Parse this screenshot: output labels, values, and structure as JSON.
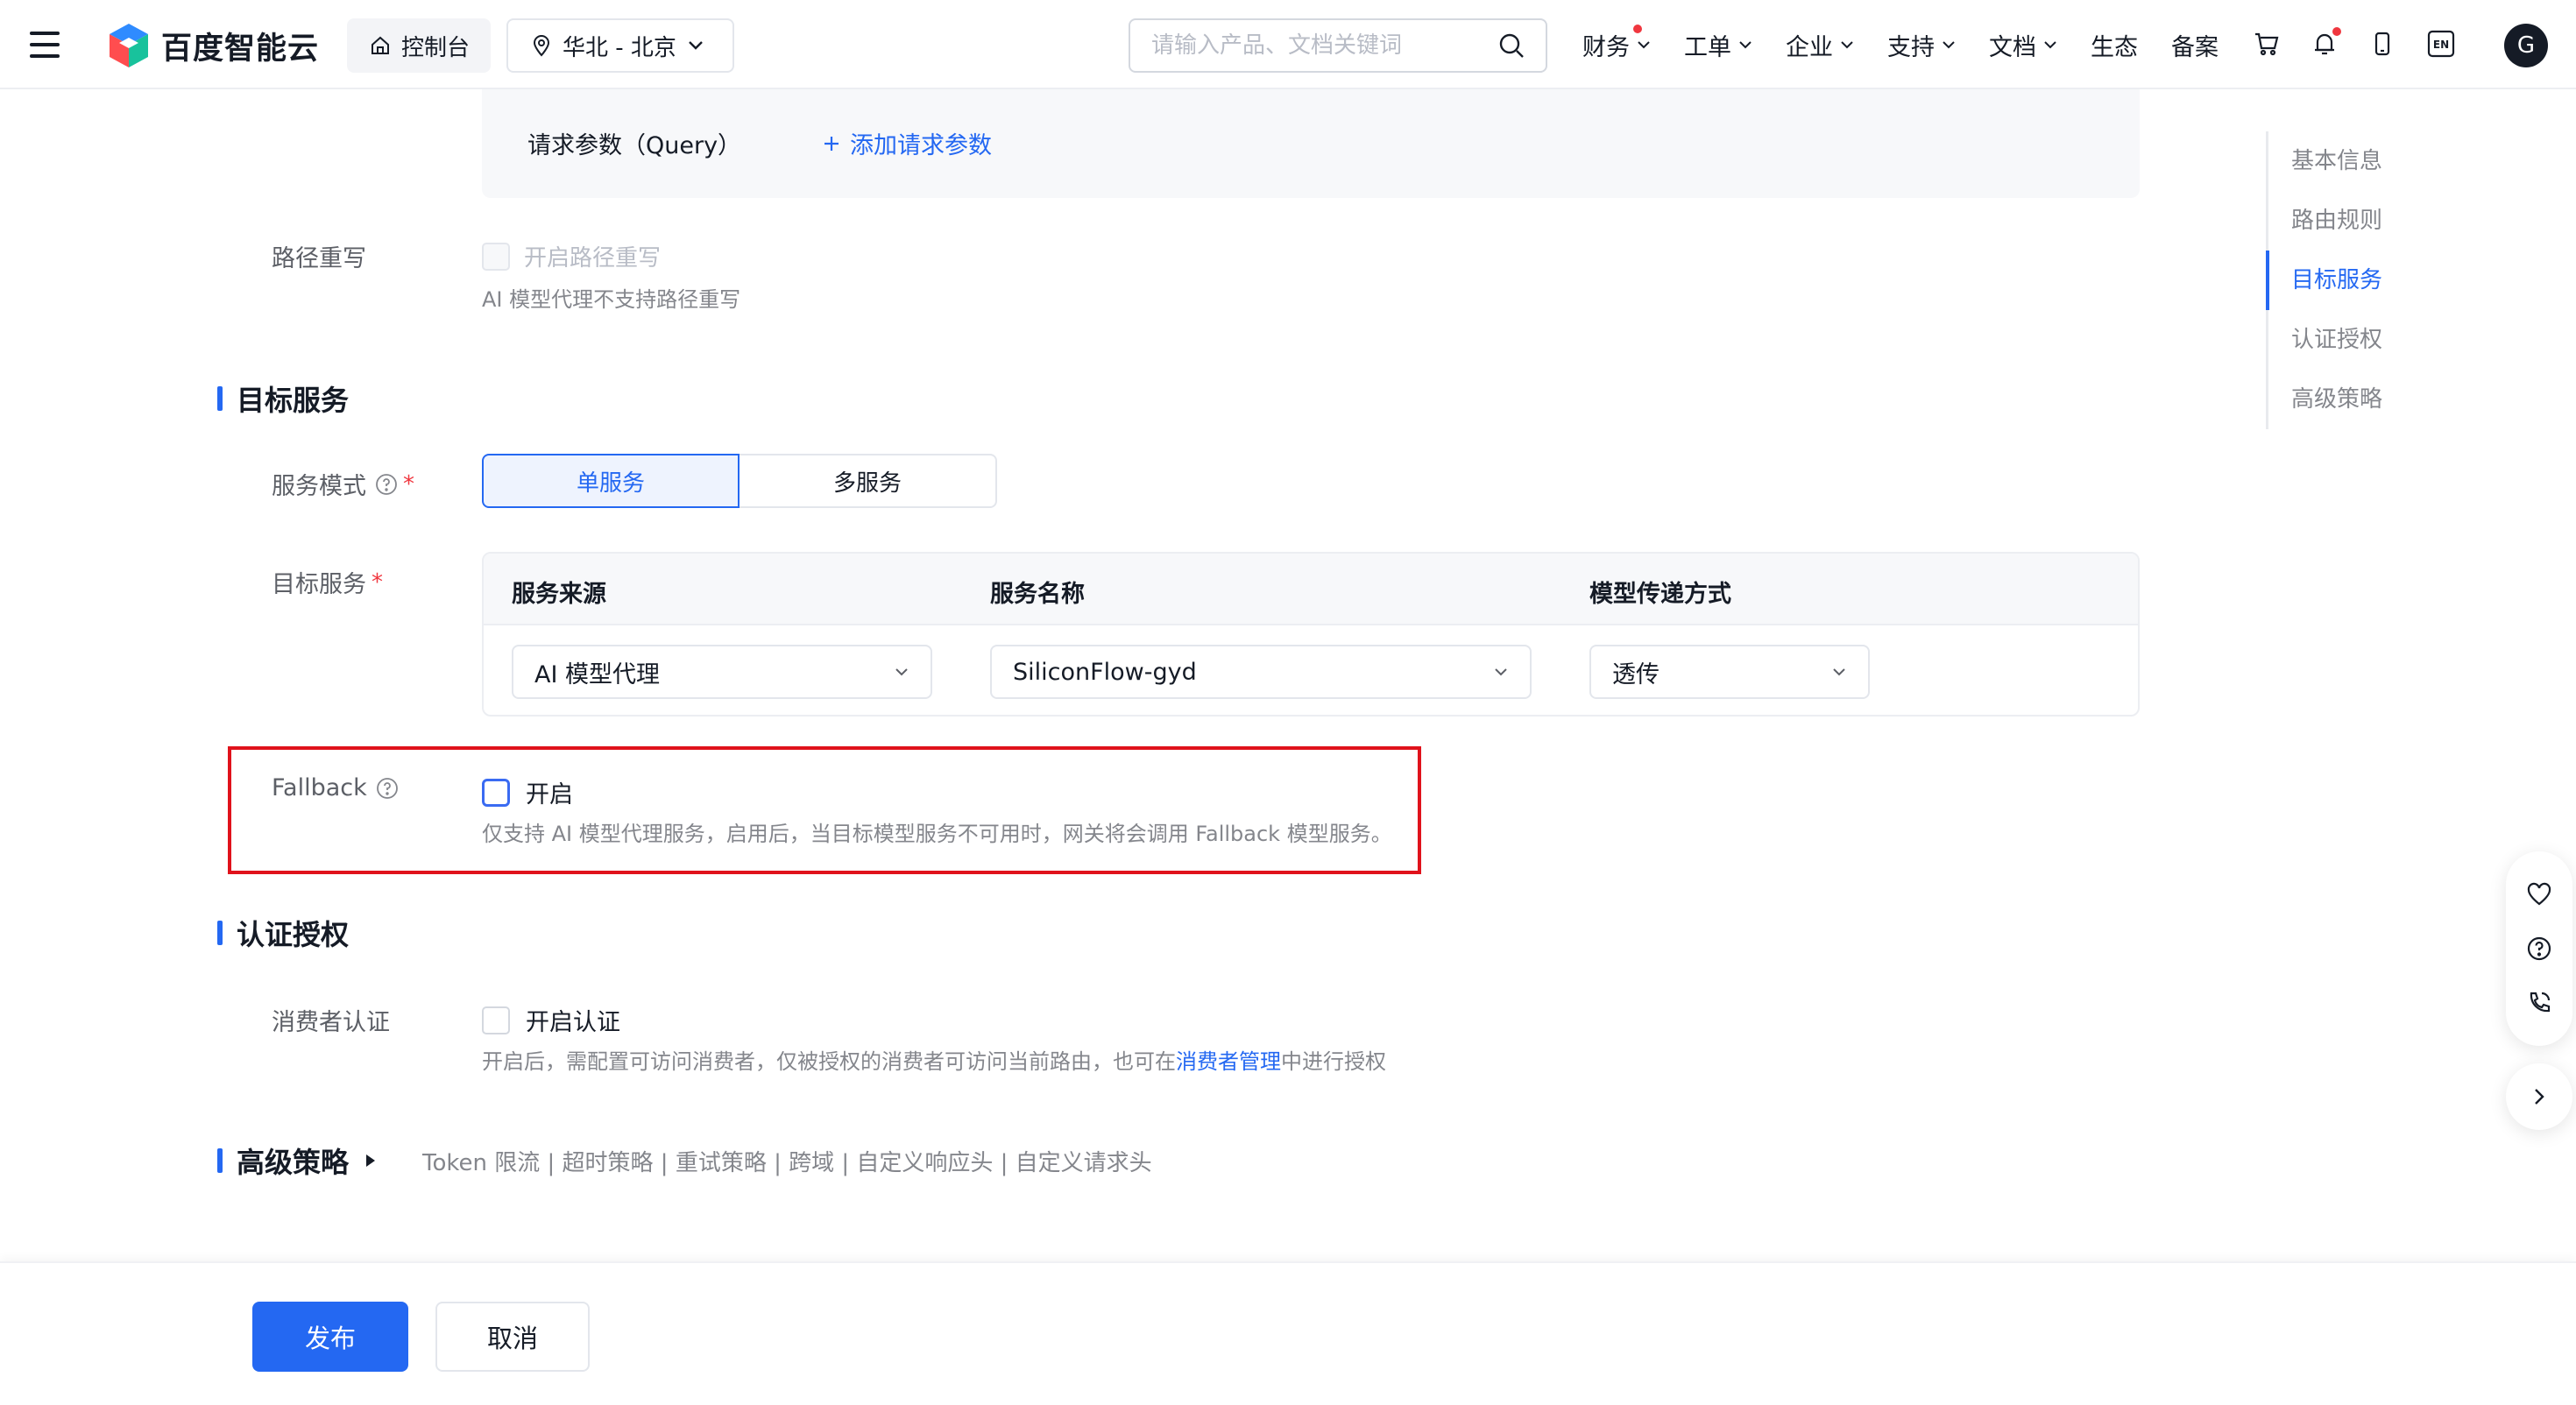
{
  "header": {
    "logo_text": "百度智能云",
    "console_label": "控制台",
    "region_label": "华北 - 北京",
    "search_placeholder": "请输入产品、文档关键词",
    "nav": [
      {
        "label": "财务",
        "dropdown": true,
        "dot": true
      },
      {
        "label": "工单",
        "dropdown": true,
        "dot": false
      },
      {
        "label": "企业",
        "dropdown": true,
        "dot": false
      },
      {
        "label": "支持",
        "dropdown": true,
        "dot": false
      },
      {
        "label": "文档",
        "dropdown": true,
        "dot": false
      },
      {
        "label": "生态",
        "dropdown": false,
        "dot": false
      },
      {
        "label": "备案",
        "dropdown": false,
        "dot": false
      }
    ],
    "lang_label": "EN",
    "avatar_letter": "G",
    "accent_color": "#2468f2"
  },
  "form": {
    "query_label": "请求参数（Query）",
    "add_query_link": "添加请求参数",
    "path_rewrite_label": "路径重写",
    "path_rewrite_checkbox": "开启路径重写",
    "path_rewrite_hint": "AI 模型代理不支持路径重写",
    "target_section_title": "目标服务",
    "service_mode_label": "服务模式",
    "service_mode_options": [
      "单服务",
      "多服务"
    ],
    "service_mode_selected": "单服务",
    "target_service_label": "目标服务",
    "table_headers": [
      "服务来源",
      "服务名称",
      "模型传递方式"
    ],
    "service_source_value": "AI 模型代理",
    "service_name_value": "SiliconFlow-gyd",
    "model_pass_value": "透传",
    "fallback_label": "Fallback",
    "fallback_checkbox": "开启",
    "fallback_hint": "仅支持 AI 模型代理服务，启用后，当目标模型服务不可用时，网关将会调用 Fallback 模型服务。",
    "auth_section_title": "认证授权",
    "consumer_auth_label": "消费者认证",
    "consumer_auth_checkbox": "开启认证",
    "consumer_hint_pre": "开启后，需配置可访问消费者，仅被授权的消费者可访问当前路由，也可在",
    "consumer_hint_link": "消费者管理",
    "consumer_hint_post": "中进行授权",
    "advanced_section_title": "高级策略",
    "advanced_summary": "Token 限流 | 超时策略 | 重试策略 | 跨域 | 自定义响应头 | 自定义请求头"
  },
  "footer": {
    "publish_label": "发布",
    "cancel_label": "取消"
  },
  "anchor": {
    "items": [
      "基本信息",
      "路由规则",
      "目标服务",
      "认证授权",
      "高级策略"
    ],
    "active": "目标服务"
  }
}
